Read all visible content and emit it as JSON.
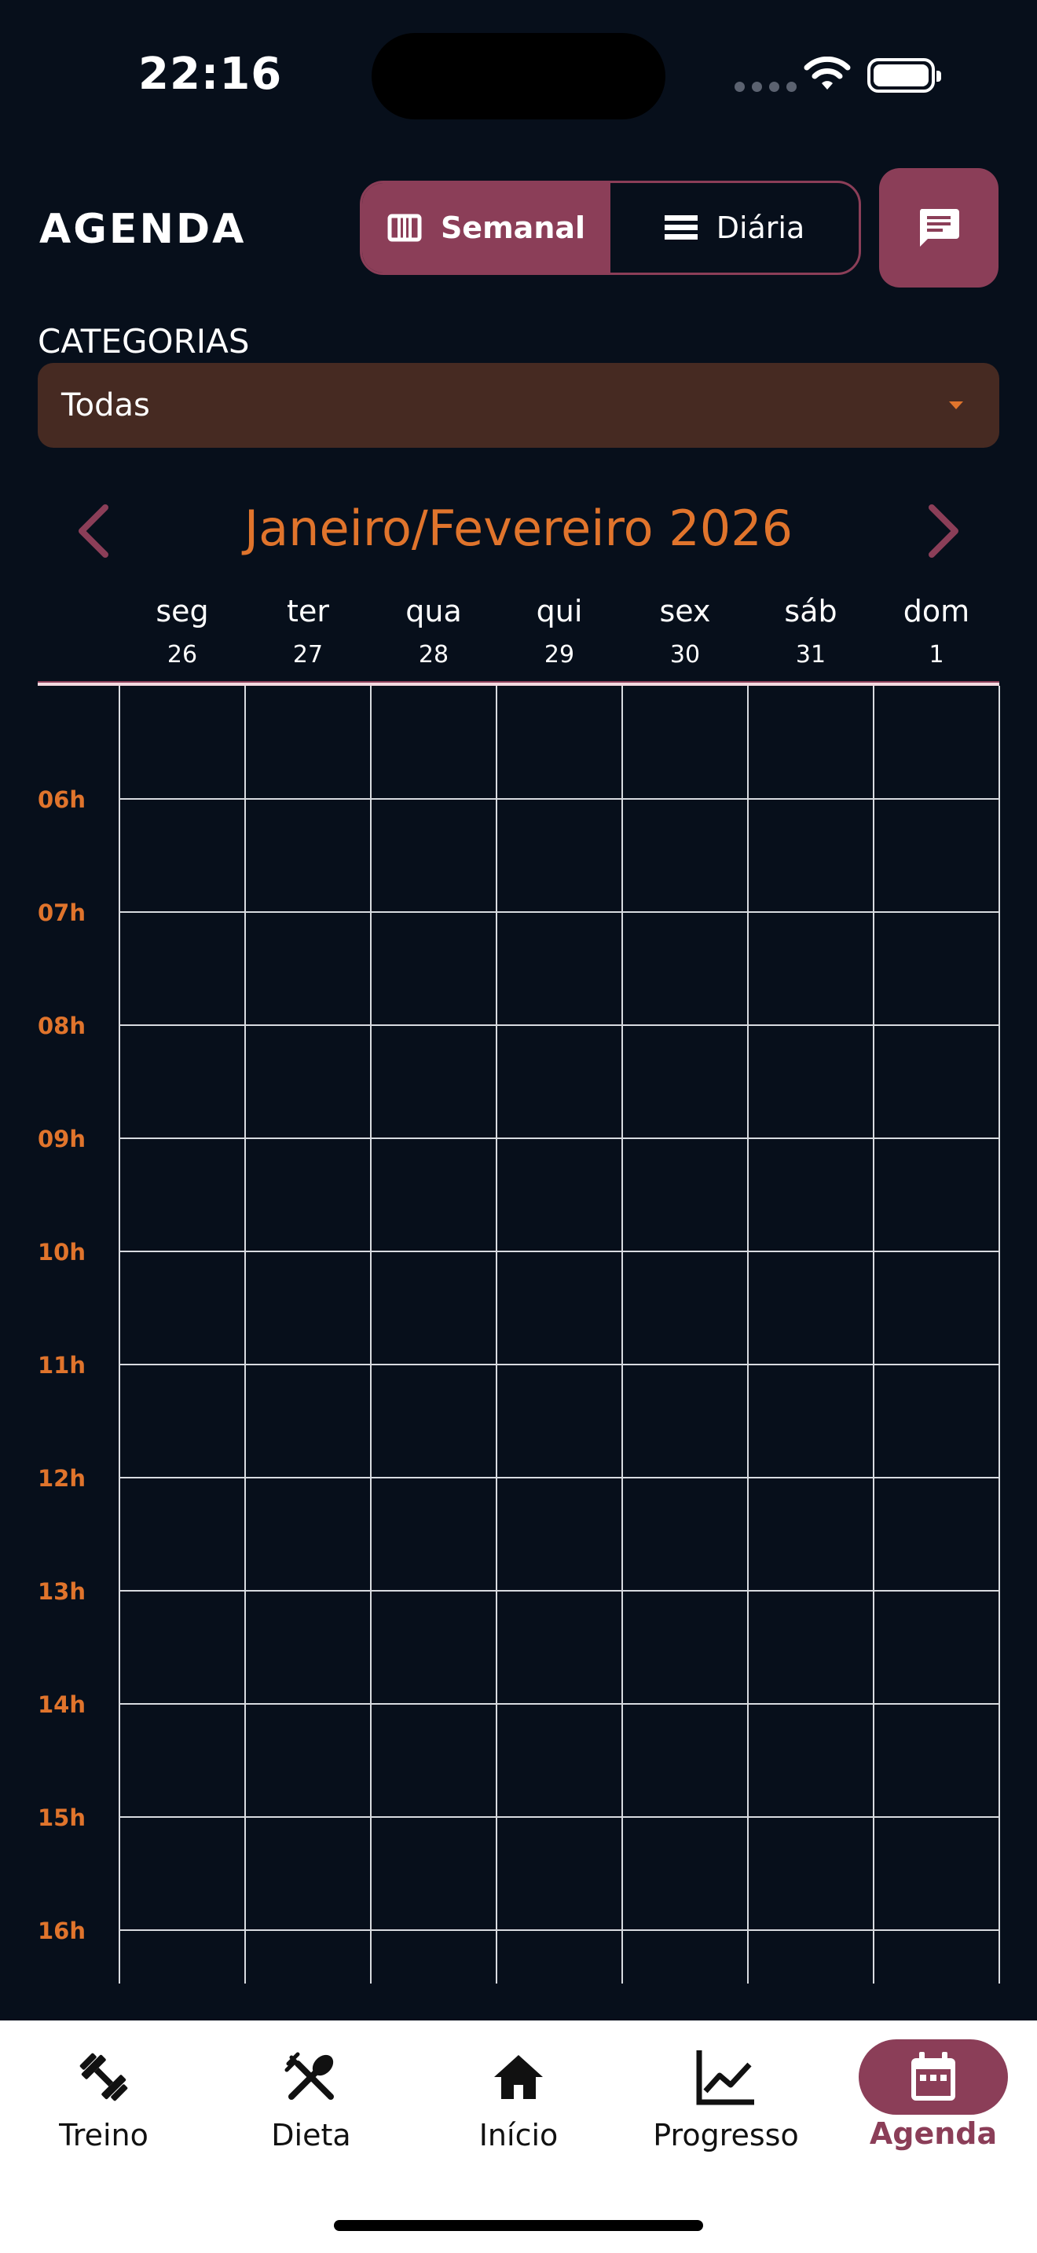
{
  "status": {
    "time": "22:16"
  },
  "header": {
    "title": "AGENDA",
    "view_toggle": {
      "weekly_label": "Semanal",
      "daily_label": "Diária",
      "active": "weekly"
    },
    "chat_icon": "chat-icon"
  },
  "filter": {
    "label": "CATEGORIAS",
    "selected": "Todas"
  },
  "calendar": {
    "period": "Janeiro/Fevereiro 2026",
    "days": [
      {
        "name": "seg",
        "date": "26"
      },
      {
        "name": "ter",
        "date": "27"
      },
      {
        "name": "qua",
        "date": "28"
      },
      {
        "name": "qui",
        "date": "29"
      },
      {
        "name": "sex",
        "date": "30"
      },
      {
        "name": "sáb",
        "date": "31"
      },
      {
        "name": "dom",
        "date": "1"
      }
    ],
    "hours": [
      "06h",
      "07h",
      "08h",
      "09h",
      "10h",
      "11h",
      "12h",
      "13h",
      "14h",
      "15h",
      "16h"
    ]
  },
  "bottom_nav": [
    {
      "label": "Treino",
      "icon": "dumbbell-icon"
    },
    {
      "label": "Dieta",
      "icon": "fork-spoon-icon"
    },
    {
      "label": "Início",
      "icon": "home-icon"
    },
    {
      "label": "Progresso",
      "icon": "chart-line-icon"
    },
    {
      "label": "Agenda",
      "icon": "calendar-icon",
      "active": true
    }
  ],
  "colors": {
    "accent": "#8B3E58",
    "orange": "#E0742C",
    "background": "#070F1B",
    "dropdown_bg": "#462A22"
  }
}
